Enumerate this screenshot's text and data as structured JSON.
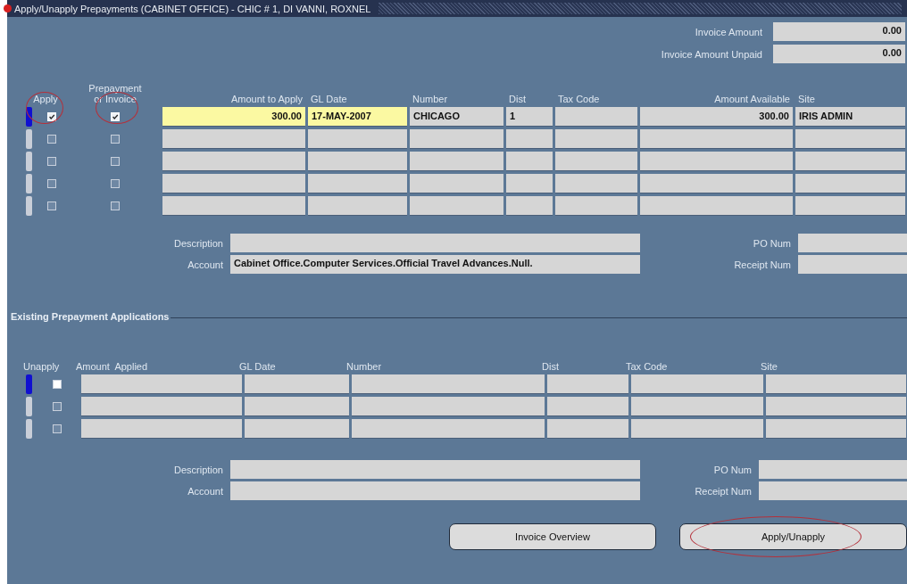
{
  "window": {
    "title": "Apply/Unapply Prepayments (CABINET OFFICE) - CHIC # 1, DI VANNI, ROXNEL"
  },
  "summary": [
    {
      "label": "Invoice Amount",
      "value": "0.00"
    },
    {
      "label": "Invoice Amount Unpaid",
      "value": "0.00"
    }
  ],
  "prepayments": {
    "check_columns": [
      {
        "label": "Apply",
        "circled": true
      },
      {
        "label_top": "Prepayment",
        "label": "or Invoice",
        "circled": true
      }
    ],
    "columns": [
      {
        "label": "Amount to Apply",
        "kind": "amount"
      },
      {
        "label": "GL Date",
        "kind": "text"
      },
      {
        "label": "Number",
        "kind": "text"
      },
      {
        "label": "Dist",
        "kind": "text"
      },
      {
        "label": "Tax Code",
        "kind": "text"
      },
      {
        "label": "Amount Available",
        "kind": "amount"
      },
      {
        "label": "Site",
        "kind": "text"
      }
    ],
    "rows": [
      {
        "current": true,
        "checks": [
          true,
          true
        ],
        "cells": [
          {
            "text": "300.00",
            "highlighted": true
          },
          {
            "text": "17-MAY-2007",
            "highlighted": true
          },
          {
            "text": "CHICAGO",
            "highlighted": false
          },
          {
            "text": "1",
            "highlighted": false
          },
          {
            "highlighted": false
          },
          {
            "text": "300.00",
            "highlighted": false
          },
          {
            "text": "IRIS ADMIN",
            "highlighted": false
          }
        ]
      },
      {
        "current": false,
        "checks": [
          false,
          false
        ]
      },
      {
        "current": false,
        "checks": [
          false,
          false
        ]
      },
      {
        "current": false,
        "checks": [
          false,
          false
        ]
      },
      {
        "current": false,
        "checks": [
          false,
          false
        ]
      }
    ],
    "details": [
      {
        "label": "Description"
      },
      {
        "label": "Account",
        "value": "Cabinet Office.Computer Services.Official Travel Advances.Null."
      }
    ],
    "refs": [
      {
        "label": "PO Num"
      },
      {
        "label": "Receipt Num"
      }
    ]
  },
  "existing": {
    "title": "Existing Prepayment Applications",
    "check_column": {
      "label": "Unapply"
    },
    "columns": [
      {
        "label": "Amount  Applied"
      },
      {
        "label": "GL Date"
      },
      {
        "label": "Number"
      },
      {
        "label": "Dist"
      },
      {
        "label": "Tax Code"
      },
      {
        "label": "Site"
      }
    ],
    "rows": [
      {
        "current": true,
        "checked": false
      },
      {
        "current": false,
        "checked": false
      },
      {
        "current": false,
        "checked": false
      }
    ],
    "details": [
      {
        "label": "Description"
      },
      {
        "label": "Account"
      }
    ],
    "refs": [
      {
        "label": "PO Num"
      },
      {
        "label": "Receipt Num"
      }
    ]
  },
  "buttons": [
    {
      "label": "Invoice Overview",
      "circled": false
    },
    {
      "label": "Apply/Unapply",
      "circled": true
    }
  ]
}
